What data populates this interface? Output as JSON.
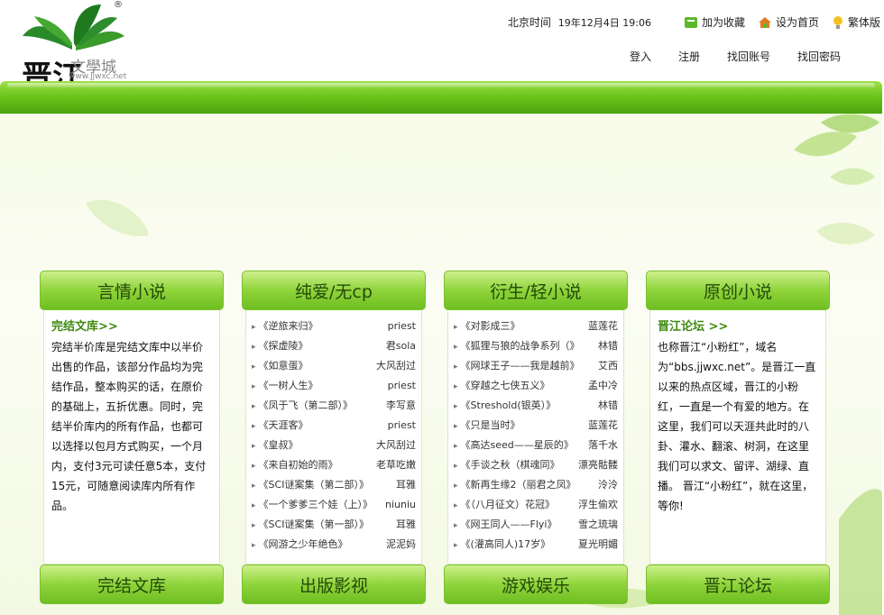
{
  "header": {
    "logo_text": "文學城",
    "logo_url_text": "www.jjwxc.net",
    "logo_glyph": "晋江",
    "registered_mark": "®",
    "time_label": "北京时间",
    "time_value": "19年12月4日 19:06",
    "add_favorite": "加为收藏",
    "set_home": "设为首页",
    "traditional": "繁体版",
    "auth": {
      "login": "登入",
      "register": "注册",
      "recover_account": "找回账号",
      "recover_password": "找回密码"
    }
  },
  "colors": {
    "band": "#6cc51c",
    "head_text": "#234a0a",
    "highlight": "#3f8a10"
  },
  "columns": [
    {
      "title": "言情小说",
      "footer": "完结文库",
      "heading": "完结文库>>",
      "text": "完结半价库是完结文库中以半价出售的作品，该部分作品均为完结作品，整本购买的话，在原价的基础上，五折优惠。同时，完结半价库内的所有作品，也都可以选择以包月方式购买，一个月内，支付3元可读任意5本，支付15元，可随意阅读库内所有作品。"
    },
    {
      "title": "纯爱/无cp",
      "footer": "出版影视",
      "items": [
        {
          "t": "《逆旅来归》",
          "a": "priest"
        },
        {
          "t": "《探虚陵》",
          "a": "君sola"
        },
        {
          "t": "《如意蛋》",
          "a": "大风刮过"
        },
        {
          "t": "《一树人生》",
          "a": "priest"
        },
        {
          "t": "《凤于飞（第二部）》",
          "a": "李写意"
        },
        {
          "t": "《天涯客》",
          "a": "priest"
        },
        {
          "t": "《皇叔》",
          "a": "大风刮过"
        },
        {
          "t": "《来自初始的雨》",
          "a": "老草吃嫩"
        },
        {
          "t": "《SCI谜案集（第二部）》",
          "a": "耳雅"
        },
        {
          "t": "《一个爹爹三个娃（上）》",
          "a": "niuniu"
        },
        {
          "t": "《SCI谜案集（第一部）》",
          "a": "耳雅"
        },
        {
          "t": "《网游之少年绝色》",
          "a": "泥泥妈"
        }
      ]
    },
    {
      "title": "衍生/轻小说",
      "footer": "游戏娱乐",
      "items": [
        {
          "t": "《对影成三》",
          "a": "蓝莲花"
        },
        {
          "t": "《狐狸与狼的战争系列（》",
          "a": "林错"
        },
        {
          "t": "《网球王子——我是越前》",
          "a": "艾西"
        },
        {
          "t": "《穿越之七侠五义》",
          "a": "孟中冷"
        },
        {
          "t": "《Streshold(银英）》",
          "a": "林错"
        },
        {
          "t": "《只是当时》",
          "a": "蓝莲花"
        },
        {
          "t": "《高达seed——星辰的》",
          "a": "落千水"
        },
        {
          "t": "《手谈之秋（棋魂同》",
          "a": "漂亮骷髅"
        },
        {
          "t": "《新再生缘2（丽君之凤》",
          "a": "泠泠"
        },
        {
          "t": "《（八月征文）花冠》",
          "a": "浮生偷欢"
        },
        {
          "t": "《网王同人——Flyi》",
          "a": "雪之琉璃"
        },
        {
          "t": "《(灌高同人)17岁》",
          "a": "夏光明媚"
        }
      ]
    },
    {
      "title": "原创小说",
      "footer": "晋江论坛",
      "heading": "晋江论坛 >>",
      "text": "也称晋江“小粉红”，域名为“bbs.jjwxc.net”。是晋江一直以来的热点区域，晋江的小粉红，一直是一个有爱的地方。在这里，我们可以天涯共此时的八卦、灌水、翻滚、树洞，在这里我们可以求文、留评、湖绿、直播。 晋江“小粉红”，就在这里，等你!"
    }
  ]
}
